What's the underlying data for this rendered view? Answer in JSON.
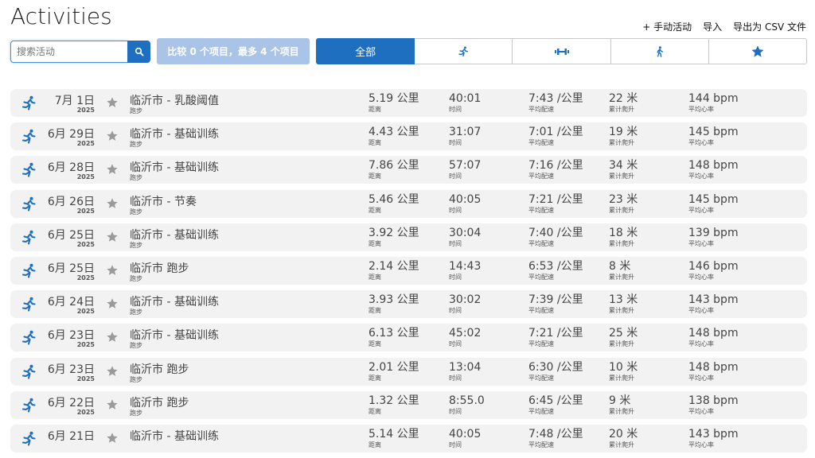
{
  "page": {
    "title": "Activities"
  },
  "links": {
    "manual": "+ 手动活动",
    "import": "导入",
    "export": "导出为 CSV 文件"
  },
  "search": {
    "placeholder": "搜索活动"
  },
  "compare": {
    "label": "比较 0 个项目，最多 4 个项目"
  },
  "filters": {
    "all": "全部"
  },
  "labels": {
    "distance": "距离",
    "time": "时间",
    "pace": "平均配速",
    "elevation": "累计爬升",
    "heart_rate": "平均心率"
  },
  "activities": [
    {
      "date": "7月 1日",
      "year": "2025",
      "name": "临沂市 - 乳酸阈值",
      "type": "跑步",
      "distance": "5.19 公里",
      "time": "40:01",
      "pace": "7:43 /公里",
      "elevation": "22 米",
      "heart_rate": "144 bpm"
    },
    {
      "date": "6月 29日",
      "year": "2025",
      "name": "临沂市 - 基础训练",
      "type": "跑步",
      "distance": "4.43 公里",
      "time": "31:07",
      "pace": "7:01 /公里",
      "elevation": "19 米",
      "heart_rate": "145 bpm"
    },
    {
      "date": "6月 28日",
      "year": "2025",
      "name": "临沂市 - 基础训练",
      "type": "跑步",
      "distance": "7.86 公里",
      "time": "57:07",
      "pace": "7:16 /公里",
      "elevation": "34 米",
      "heart_rate": "148 bpm"
    },
    {
      "date": "6月 26日",
      "year": "2025",
      "name": "临沂市 - 节奏",
      "type": "跑步",
      "distance": "5.46 公里",
      "time": "40:05",
      "pace": "7:21 /公里",
      "elevation": "23 米",
      "heart_rate": "145 bpm"
    },
    {
      "date": "6月 25日",
      "year": "2025",
      "name": "临沂市 - 基础训练",
      "type": "跑步",
      "distance": "3.92 公里",
      "time": "30:04",
      "pace": "7:40 /公里",
      "elevation": "18 米",
      "heart_rate": "139 bpm"
    },
    {
      "date": "6月 25日",
      "year": "2025",
      "name": "临沂市 跑步",
      "type": "跑步",
      "distance": "2.14 公里",
      "time": "14:43",
      "pace": "6:53 /公里",
      "elevation": "8 米",
      "heart_rate": "146 bpm"
    },
    {
      "date": "6月 24日",
      "year": "2025",
      "name": "临沂市 - 基础训练",
      "type": "跑步",
      "distance": "3.93 公里",
      "time": "30:02",
      "pace": "7:39 /公里",
      "elevation": "13 米",
      "heart_rate": "143 bpm"
    },
    {
      "date": "6月 23日",
      "year": "2025",
      "name": "临沂市 - 基础训练",
      "type": "跑步",
      "distance": "6.13 公里",
      "time": "45:02",
      "pace": "7:21 /公里",
      "elevation": "25 米",
      "heart_rate": "148 bpm"
    },
    {
      "date": "6月 23日",
      "year": "2025",
      "name": "临沂市 跑步",
      "type": "跑步",
      "distance": "2.01 公里",
      "time": "13:04",
      "pace": "6:30 /公里",
      "elevation": "10 米",
      "heart_rate": "148 bpm"
    },
    {
      "date": "6月 22日",
      "year": "2025",
      "name": "临沂市 跑步",
      "type": "跑步",
      "distance": "1.32 公里",
      "time": "8:55.0",
      "pace": "6:45 /公里",
      "elevation": "9 米",
      "heart_rate": "138 bpm"
    },
    {
      "date": "6月 21日",
      "year": "",
      "name": "临沂市 - 基础训练",
      "type": "",
      "distance": "5.14 公里",
      "time": "40:05",
      "pace": "7:48 /公里",
      "elevation": "20 米",
      "heart_rate": "143 bpm"
    }
  ],
  "colors": {
    "accent": "#1f6fc0",
    "compare_bg": "#a9c4e6",
    "row_bg": "#f2f2f2",
    "star": "#9a9a9a"
  },
  "icons": {
    "search": "search-icon",
    "run": "running-icon",
    "strength": "strength-icon",
    "walk": "walking-icon",
    "favorite": "star-icon"
  }
}
